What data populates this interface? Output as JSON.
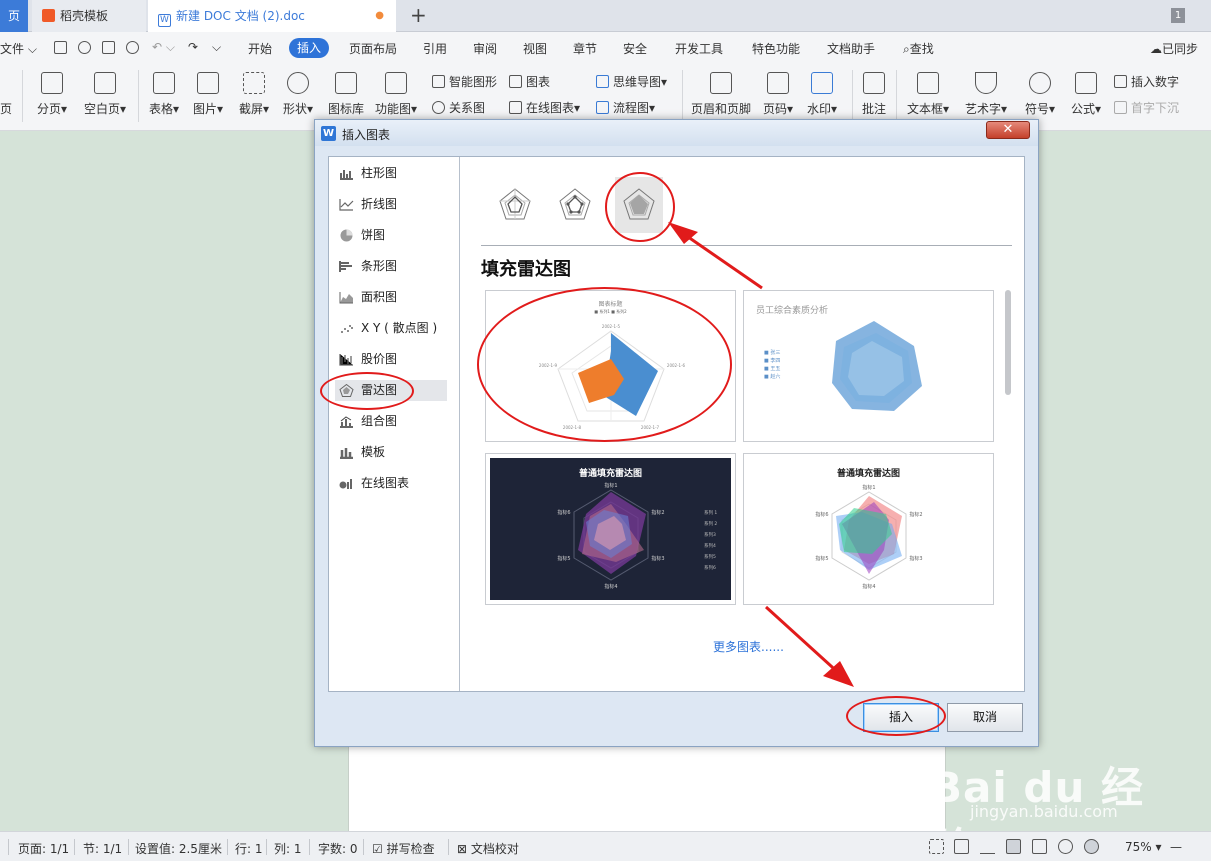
{
  "tabs": {
    "home_label": "页",
    "tab1_label": "稻壳模板",
    "tab2_label": "新建 DOC 文档 (2).doc",
    "modified_dot": "●",
    "new_tab": "+",
    "window_count": "1"
  },
  "menu": {
    "file": "文件",
    "items": [
      "开始",
      "插入",
      "页面布局",
      "引用",
      "审阅",
      "视图",
      "章节",
      "安全",
      "开发工具",
      "特色功能",
      "文档助手",
      "查找"
    ],
    "sync": "已同步"
  },
  "ribbon": {
    "left_cut": "页",
    "page_break": "分页",
    "blank_page": "空白页",
    "table": "表格",
    "picture": "图片",
    "screenshot": "截屏",
    "shape": "形状",
    "icon_lib": "图标库",
    "func_chart": "功能图",
    "smart_shape": "智能图形",
    "chart": "图表",
    "mind_map": "思维导图",
    "relation": "关系图",
    "online_chart": "在线图表",
    "flow_chart": "流程图",
    "header_footer": "页眉和页脚",
    "page_num": "页码",
    "watermark": "水印",
    "comment": "批注",
    "textbox": "文本框",
    "wordart": "艺术字",
    "symbol": "符号",
    "formula": "公式",
    "insert_number": "插入数字",
    "drop_cap": "首字下沉"
  },
  "dialog": {
    "title": "插入图表",
    "close": "✕",
    "categories": [
      "柱形图",
      "折线图",
      "饼图",
      "条形图",
      "面积图",
      "X Y ( 散点图 )",
      "股价图",
      "雷达图",
      "组合图",
      "模板",
      "在线图表"
    ],
    "selected_category": "雷达图",
    "section_title": "填充雷达图",
    "thumbnails": {
      "t1_title": "图表标题",
      "t1_legend": "■ 系列1  ■ 系列2",
      "t1_axis_labels": [
        "2002-1-5",
        "2002-1-6",
        "2002-1-7",
        "2002-1-8",
        "2002-1-9"
      ],
      "t2_title": "员工综合素质分析",
      "t2_legend": [
        "■ 张三",
        "■ 李四",
        "■ 王五",
        "■ 赵六"
      ],
      "t3_title": "普通填充雷达图",
      "t3_indicators": [
        "指标1",
        "指标2",
        "指标3",
        "指标4",
        "指标5",
        "指标6"
      ],
      "t3_legend": [
        "系列 1",
        "系列 2",
        "系列3",
        "系列4",
        "系列5",
        "系列6"
      ],
      "t4_title": "普通填充雷达图",
      "t4_indicators": [
        "指标1",
        "指标2",
        "指标3",
        "指标4",
        "指标5",
        "指标6"
      ]
    },
    "more_charts": "更多图表......",
    "insert_btn": "插入",
    "cancel_btn": "取消"
  },
  "statusbar": {
    "left_cut": " ",
    "page": "页面: 1/1",
    "section": "节: 1/1",
    "setting": "设置值: 2.5厘米",
    "row": "行: 1",
    "col": "列: 1",
    "word_count": "字数: 0",
    "spell_check": "拼写检查",
    "doc_proof": "文档校对",
    "zoom": "75%",
    "zoom_minus": "—"
  },
  "watermark": {
    "text": "Bai du 经验",
    "sub": "jingyan.baidu.com"
  },
  "colors": {
    "accent": "#2e73d8",
    "annotation": "#e11b1b",
    "doc_bg": "#d5e3d8"
  }
}
